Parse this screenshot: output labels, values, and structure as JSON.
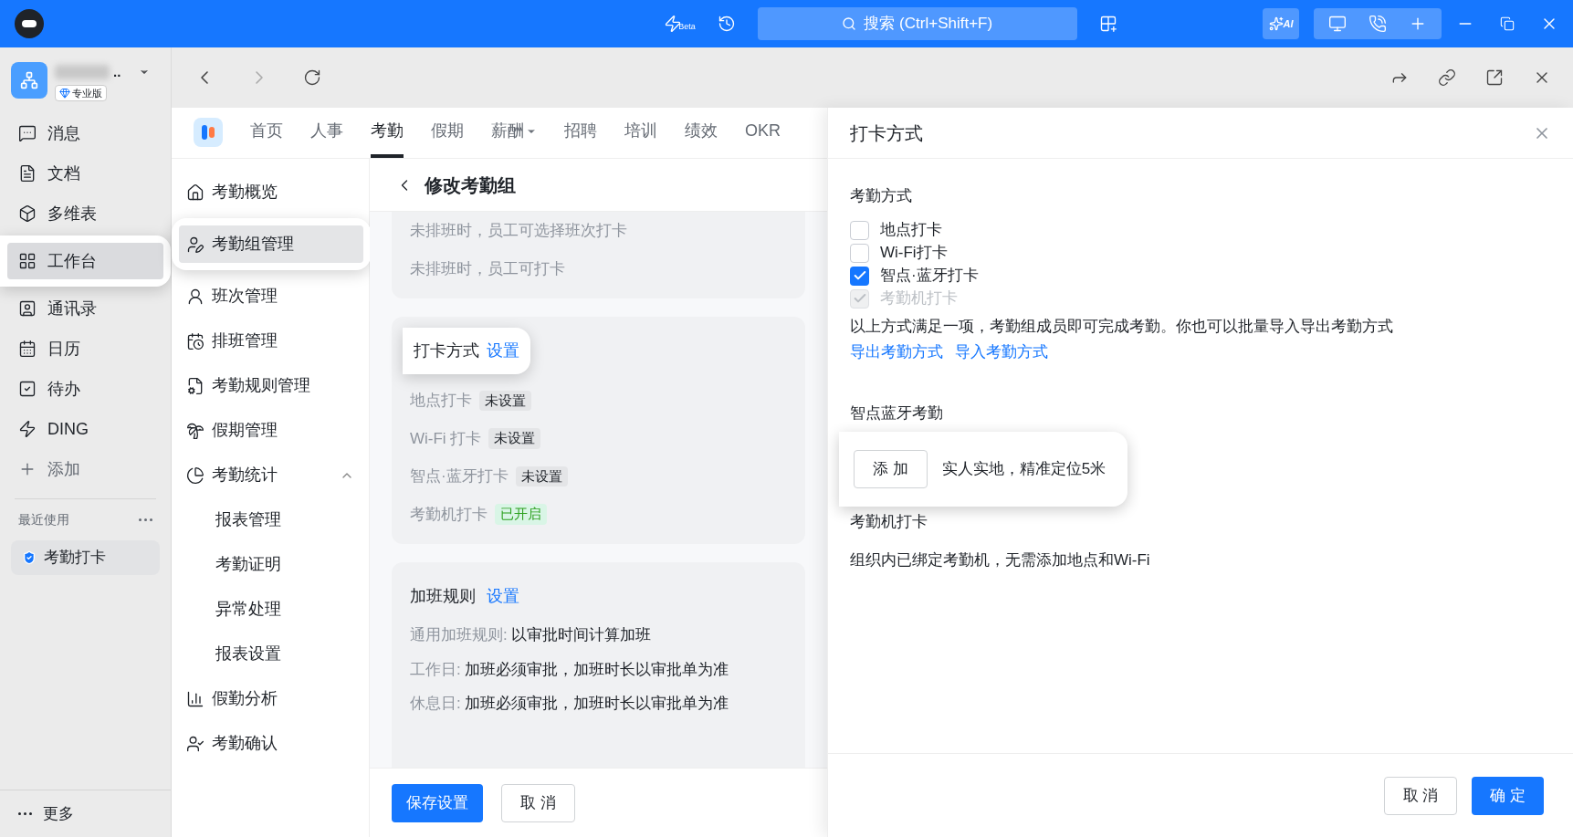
{
  "title_bar": {
    "beta_label": "Beta",
    "search": {
      "placeholder": "搜索 (Ctrl+Shift+F)"
    },
    "ai_label": "AI"
  },
  "org": {
    "name": "..",
    "badge": "专业版"
  },
  "sidebar": {
    "items": [
      {
        "label": "消息",
        "selected": false,
        "spotlight": false
      },
      {
        "label": "文档",
        "selected": false,
        "spotlight": false
      },
      {
        "label": "多维表",
        "selected": false,
        "spotlight": false
      },
      {
        "label": "工作台",
        "selected": true,
        "spotlight": true
      },
      {
        "label": "通讯录",
        "selected": false,
        "spotlight": false
      },
      {
        "label": "日历",
        "selected": false,
        "spotlight": false
      },
      {
        "label": "待办",
        "selected": false,
        "spotlight": false
      },
      {
        "label": "DING",
        "selected": false,
        "spotlight": false
      }
    ],
    "add_label": "添加",
    "recent_title": "最近使用",
    "recent_items": [
      {
        "label": "考勤打卡"
      }
    ],
    "more_label": "更多"
  },
  "app_tabs": [
    {
      "label": "首页",
      "selected": false,
      "has_menu": false
    },
    {
      "label": "人事",
      "selected": false,
      "has_menu": false
    },
    {
      "label": "考勤",
      "selected": true,
      "has_menu": false
    },
    {
      "label": "假期",
      "selected": false,
      "has_menu": false
    },
    {
      "label": "薪酬",
      "selected": false,
      "has_menu": true
    },
    {
      "label": "招聘",
      "selected": false,
      "has_menu": false
    },
    {
      "label": "培训",
      "selected": false,
      "has_menu": false
    },
    {
      "label": "绩效",
      "selected": false,
      "has_menu": false
    },
    {
      "label": "OKR",
      "selected": false,
      "has_menu": false
    }
  ],
  "menu": {
    "items": [
      {
        "label": "考勤概览",
        "selected": false,
        "spotlight": false
      },
      {
        "label": "考勤组管理",
        "selected": true,
        "spotlight": true
      },
      {
        "label": "班次管理",
        "selected": false,
        "spotlight": false
      },
      {
        "label": "排班管理",
        "selected": false,
        "spotlight": false
      },
      {
        "label": "考勤规则管理",
        "selected": false,
        "spotlight": false
      },
      {
        "label": "假期管理",
        "selected": false,
        "spotlight": false
      },
      {
        "label": "考勤统计",
        "selected": false,
        "spotlight": false,
        "expanded": true,
        "children": [
          {
            "label": "报表管理",
            "selected": false
          },
          {
            "label": "考勤证明",
            "selected": false
          },
          {
            "label": "异常处理",
            "selected": false
          },
          {
            "label": "报表设置",
            "selected": false
          }
        ]
      },
      {
        "label": "假勤分析",
        "selected": false,
        "spotlight": false
      },
      {
        "label": "考勤确认",
        "selected": false,
        "spotlight": false
      }
    ]
  },
  "page": {
    "title": "修改考勤组",
    "shift_lines": [
      "未排班时，员工可选择班次打卡",
      "未排班时，员工可打卡"
    ],
    "punch_card": {
      "title": "打卡方式",
      "link": "设置",
      "spotlight": true,
      "rows": [
        {
          "label": "地点打卡",
          "status": "未设置",
          "enabled": false
        },
        {
          "label": "Wi-Fi 打卡",
          "status": "未设置",
          "enabled": false
        },
        {
          "label": "智点·蓝牙打卡",
          "status": "未设置",
          "enabled": false
        },
        {
          "label": "考勤机打卡",
          "status": "已开启",
          "enabled": true
        }
      ]
    },
    "overtime_card": {
      "title": "加班规则",
      "link": "设置",
      "rows": [
        {
          "label": "通用加班规则:",
          "value": "以审批时间计算加班"
        },
        {
          "label": "工作日:",
          "value": "加班必须审批，加班时长以审批单为准"
        },
        {
          "label": "休息日:",
          "value": "加班必须审批，加班时长以审批单为准"
        }
      ]
    },
    "save_button": "保存设置",
    "cancel_button": "取 消"
  },
  "drawer": {
    "title": "打卡方式",
    "methods_title": "考勤方式",
    "options": [
      {
        "label": "地点打卡",
        "checked": false,
        "disabled": false
      },
      {
        "label": "Wi-Fi打卡",
        "checked": false,
        "disabled": false
      },
      {
        "label": "智点·蓝牙打卡",
        "checked": true,
        "disabled": false
      },
      {
        "label": "考勤机打卡",
        "checked": true,
        "disabled": true
      }
    ],
    "note": "以上方式满足一项，考勤组成员即可完成考勤。你也可以批量导入导出考勤方式",
    "export_link": "导出考勤方式",
    "import_link": "导入考勤方式",
    "bluetooth": {
      "title": "智点蓝牙考勤",
      "add_button": "添 加",
      "hint": "实人实地，精准定位5米",
      "spotlight": true
    },
    "machine": {
      "title": "考勤机打卡",
      "text": "组织内已绑定考勤机，无需添加地点和Wi-Fi"
    },
    "cancel_button": "取 消",
    "ok_button": "确 定"
  }
}
